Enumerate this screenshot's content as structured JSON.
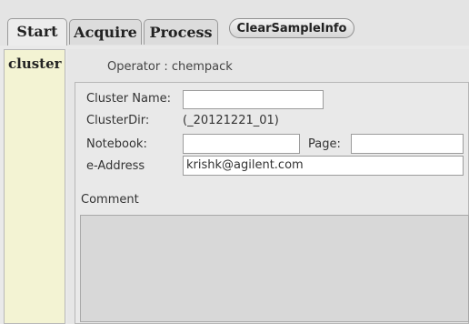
{
  "tabs": [
    {
      "label": "Start"
    },
    {
      "label": "Acquire"
    },
    {
      "label": "Process"
    }
  ],
  "toolbar": {
    "clear_label": "ClearSampleInfo"
  },
  "left_panel": {
    "label": "cluster"
  },
  "operator": {
    "text": "Operator : chempack"
  },
  "form": {
    "cluster_name_label": "Cluster Name:",
    "cluster_name_value": "",
    "cluster_dir_label": "ClusterDir:",
    "cluster_dir_value": "(_20121221_01)",
    "notebook_label": "Notebook:",
    "notebook_value": "",
    "page_label": "Page:",
    "page_value": "",
    "email_label": "e-Address",
    "email_value": "krishk@agilent.com",
    "comment_label": "Comment",
    "comment_value": ""
  }
}
